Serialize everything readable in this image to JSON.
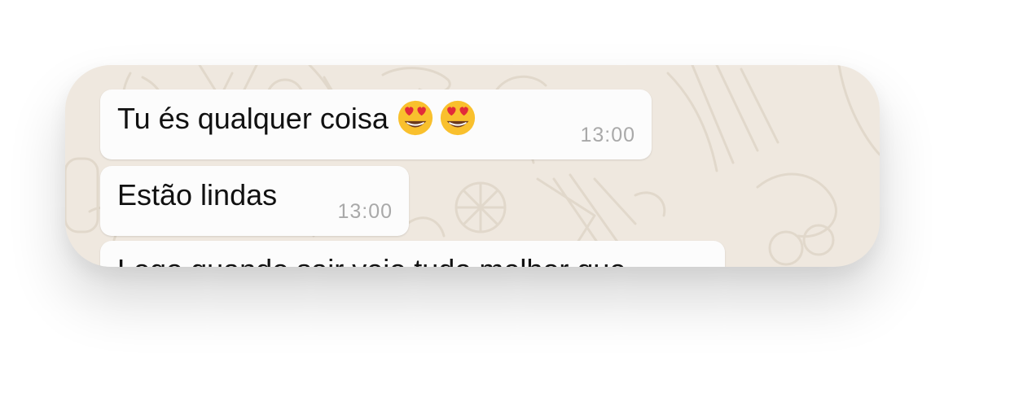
{
  "chat": {
    "messages": [
      {
        "text": "Tu és qualquer coisa",
        "emojis": [
          "heart-eyes-emoji",
          "heart-eyes-emoji"
        ],
        "time": "13:00"
      },
      {
        "text": "Estão lindas",
        "time": "13:00"
      },
      {
        "text": "Logo quando sair vejo tudo melhor que",
        "time": ""
      }
    ]
  },
  "colors": {
    "wallpaper": "#efe8df",
    "bubble": "#fcfcfc",
    "time": "#a9a9a9",
    "text": "#111111"
  }
}
